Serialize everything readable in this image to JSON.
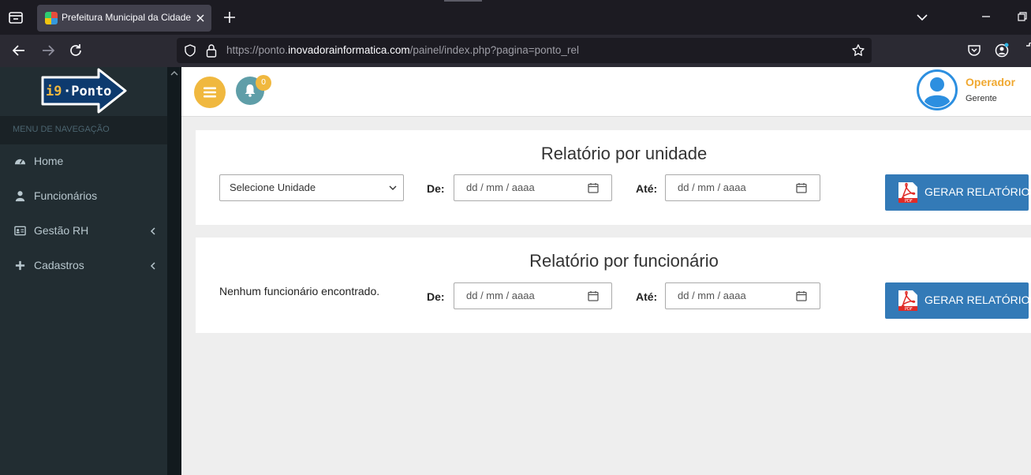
{
  "browser": {
    "tab_title": "Prefeitura Municipal da Cidade",
    "url_prefix": "https://ponto.",
    "url_domain": "inovadorainformatica.com",
    "url_path": "/painel/index.php?pagina=ponto_rel"
  },
  "sidebar": {
    "logo_text": "i9·Ponto",
    "menu_header": "MENU DE NAVEGAÇÃO",
    "items": [
      {
        "label": "Home",
        "icon": "dashboard-icon"
      },
      {
        "label": "Funcionários",
        "icon": "user-icon"
      },
      {
        "label": "Gestão RH",
        "icon": "id-card-icon",
        "has_submenu": true
      },
      {
        "label": "Cadastros",
        "icon": "plus-icon",
        "has_submenu": true
      }
    ]
  },
  "topbar": {
    "notification_count": "0",
    "user_name": "Operador",
    "user_role": "Gerente"
  },
  "report_unit": {
    "title": "Relatório por unidade",
    "select_value": "Selecione Unidade",
    "from_label": "De:",
    "to_label": "Até:",
    "from_placeholder": "dd / mm / aaaa",
    "to_placeholder": "dd / mm / aaaa",
    "button_label": "GERAR RELATÓRIO"
  },
  "report_employee": {
    "title": "Relatório por funcionário",
    "empty_message": "Nenhum funcionário encontrado.",
    "from_label": "De:",
    "to_label": "Até:",
    "from_placeholder": "dd / mm / aaaa",
    "to_placeholder": "dd / mm / aaaa",
    "button_label": "GERAR RELATÓRIO"
  },
  "colors": {
    "sidebar_bg": "#222d32",
    "accent_orange": "#f0b83f",
    "button_blue": "#337ab7",
    "bell_teal": "#5f9ea8"
  }
}
